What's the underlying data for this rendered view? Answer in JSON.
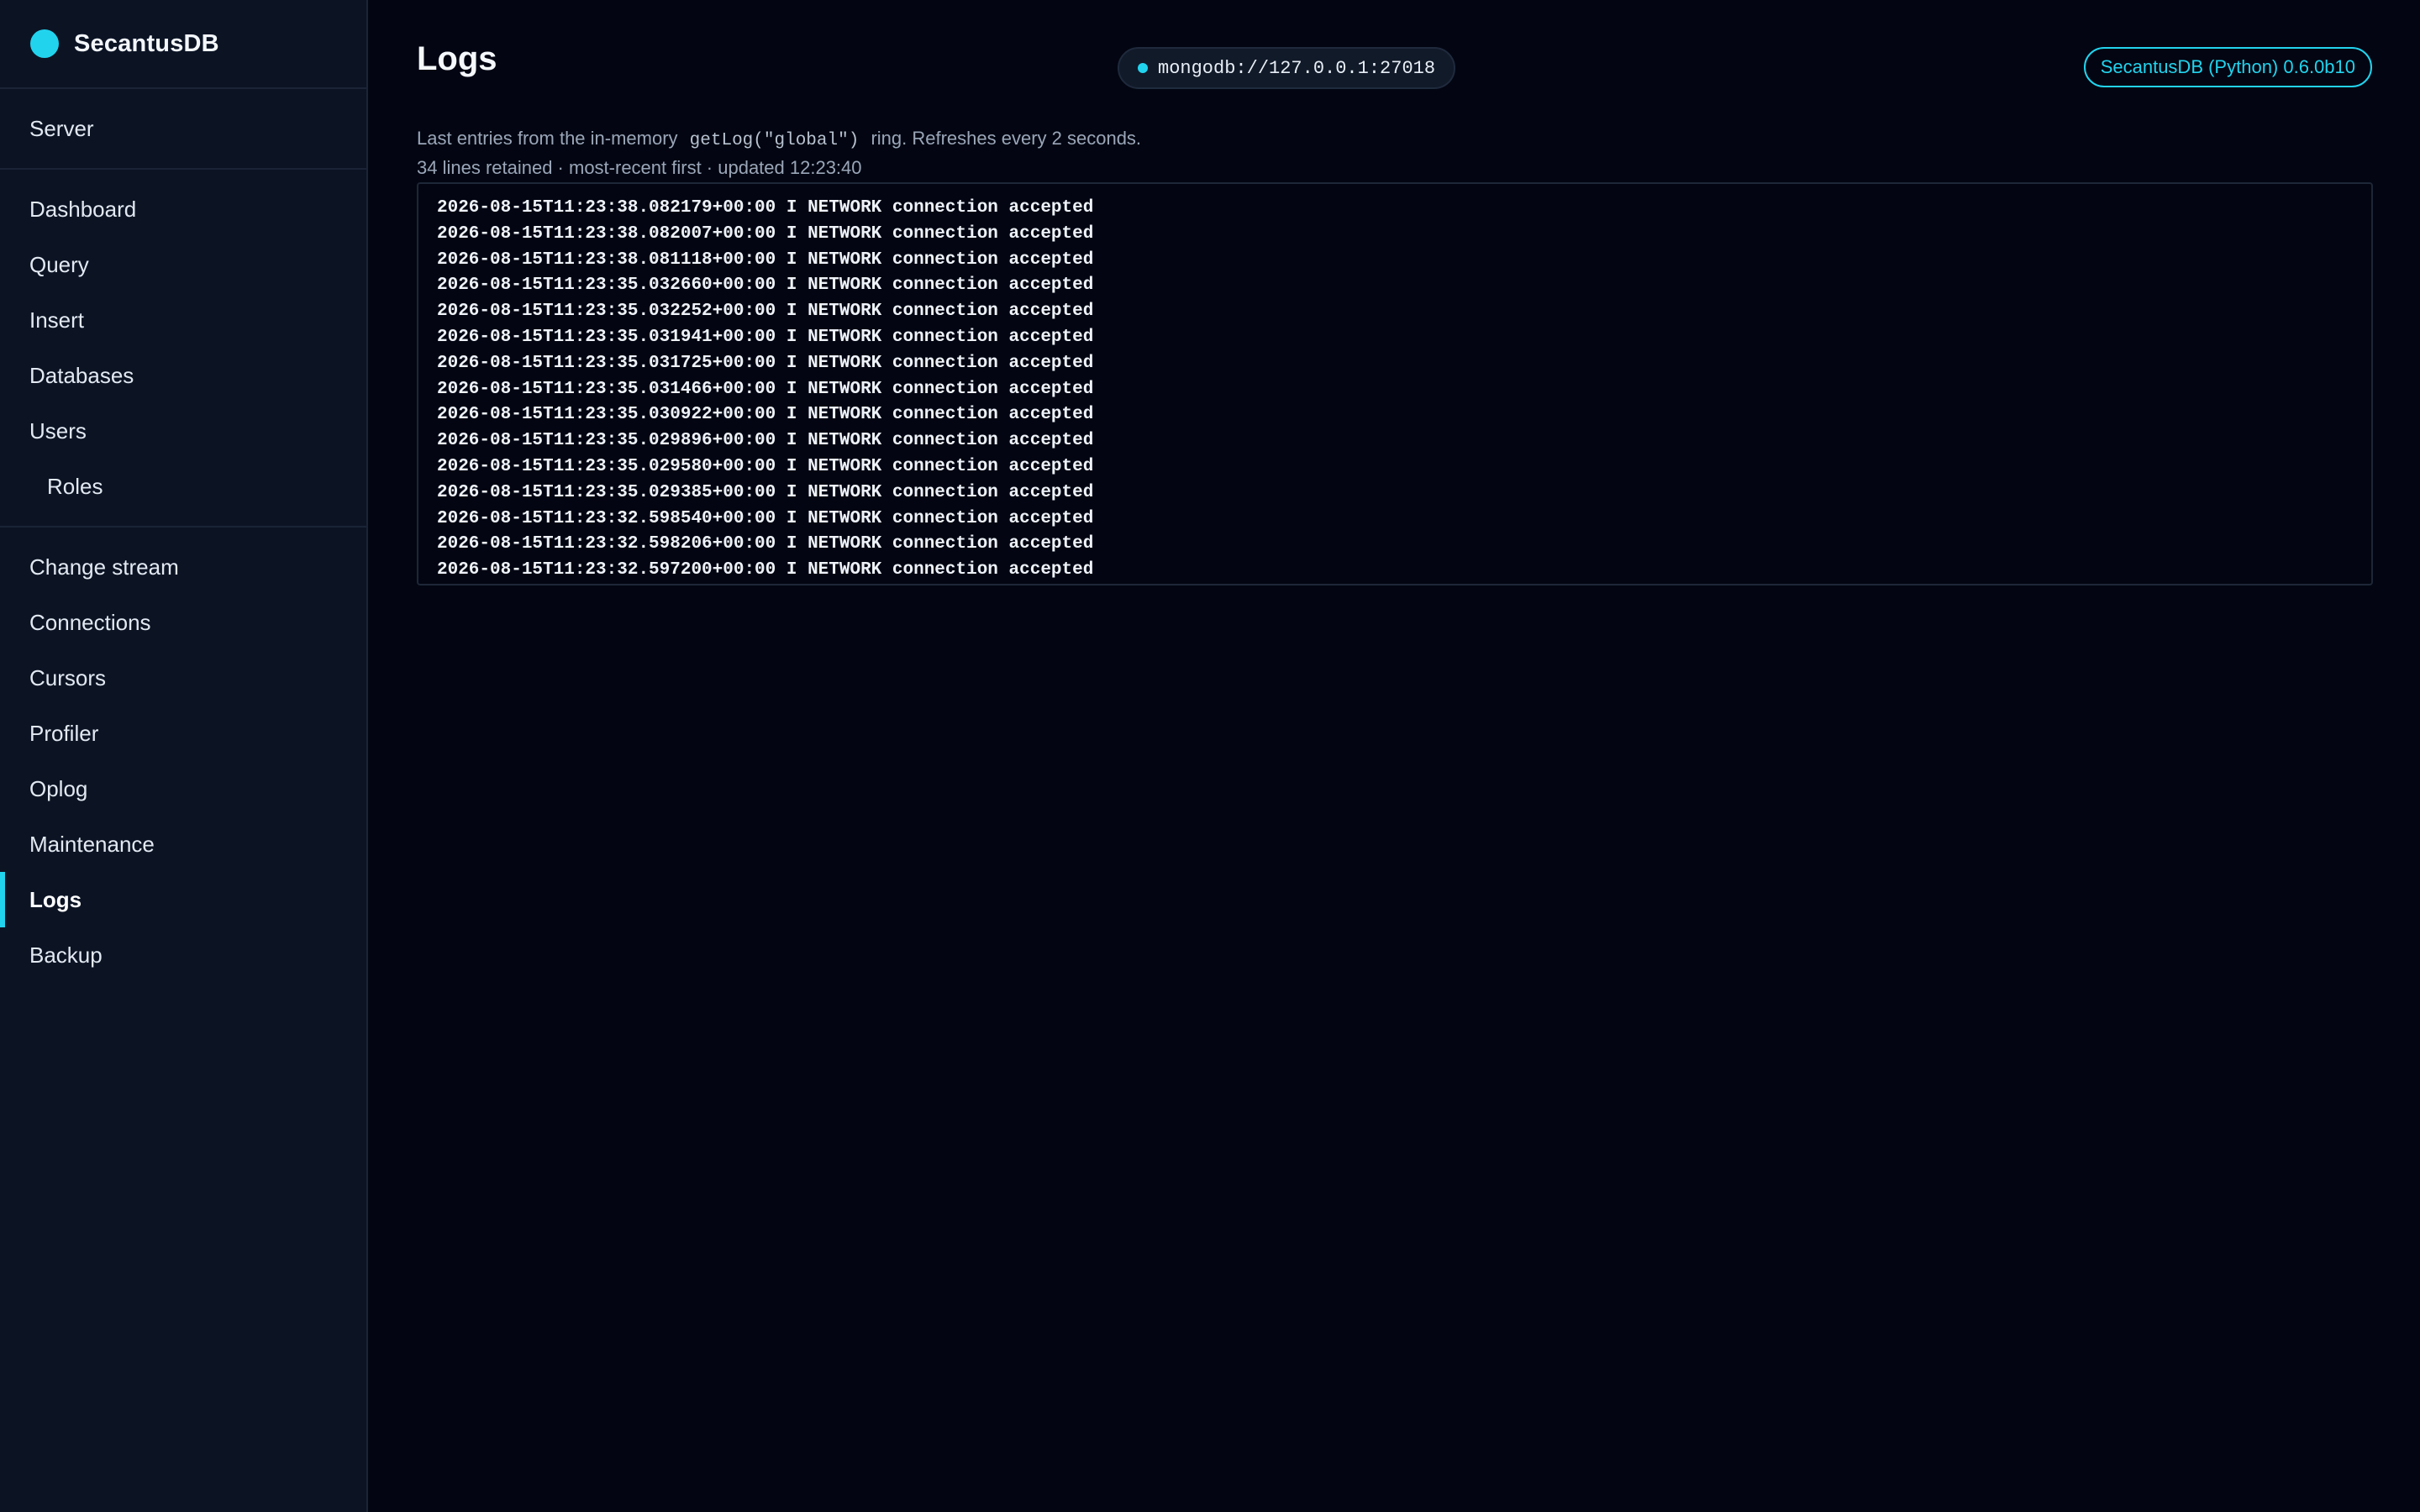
{
  "sidebar": {
    "brand": "SecantusDB",
    "groups": [
      {
        "items": [
          {
            "label": "Server"
          }
        ]
      },
      {
        "items": [
          {
            "label": "Dashboard"
          },
          {
            "label": "Query"
          },
          {
            "label": "Insert"
          },
          {
            "label": "Databases"
          },
          {
            "label": "Users"
          },
          {
            "label": "Roles"
          }
        ]
      },
      {
        "items": [
          {
            "label": "Change stream"
          },
          {
            "label": "Connections"
          },
          {
            "label": "Cursors"
          },
          {
            "label": "Profiler"
          },
          {
            "label": "Oplog"
          },
          {
            "label": "Maintenance"
          },
          {
            "label": "Logs"
          },
          {
            "label": "Backup"
          }
        ]
      }
    ],
    "active_item": "Logs"
  },
  "header": {
    "title": "Logs",
    "connection": "mongodb://127.0.0.1:27018",
    "version": "SecantusDB (Python) 0.6.0b10"
  },
  "description": {
    "prefix": "Last entries from the in-memory",
    "code": "getLog(\"global\")",
    "suffix": "ring. Refreshes every 2 seconds."
  },
  "meta": "34 lines retained · most-recent first · updated 12:23:40",
  "logs": [
    "2026-08-15T11:23:38.082179+00:00 I NETWORK connection accepted",
    "2026-08-15T11:23:38.082007+00:00 I NETWORK connection accepted",
    "2026-08-15T11:23:38.081118+00:00 I NETWORK connection accepted",
    "2026-08-15T11:23:35.032660+00:00 I NETWORK connection accepted",
    "2026-08-15T11:23:35.032252+00:00 I NETWORK connection accepted",
    "2026-08-15T11:23:35.031941+00:00 I NETWORK connection accepted",
    "2026-08-15T11:23:35.031725+00:00 I NETWORK connection accepted",
    "2026-08-15T11:23:35.031466+00:00 I NETWORK connection accepted",
    "2026-08-15T11:23:35.030922+00:00 I NETWORK connection accepted",
    "2026-08-15T11:23:35.029896+00:00 I NETWORK connection accepted",
    "2026-08-15T11:23:35.029580+00:00 I NETWORK connection accepted",
    "2026-08-15T11:23:35.029385+00:00 I NETWORK connection accepted",
    "2026-08-15T11:23:32.598540+00:00 I NETWORK connection accepted",
    "2026-08-15T11:23:32.598206+00:00 I NETWORK connection accepted",
    "2026-08-15T11:23:32.597200+00:00 I NETWORK connection accepted"
  ],
  "colors": {
    "accent": "#22d3ee",
    "sidebar_bg": "#0c1424",
    "main_bg": "#030612"
  }
}
